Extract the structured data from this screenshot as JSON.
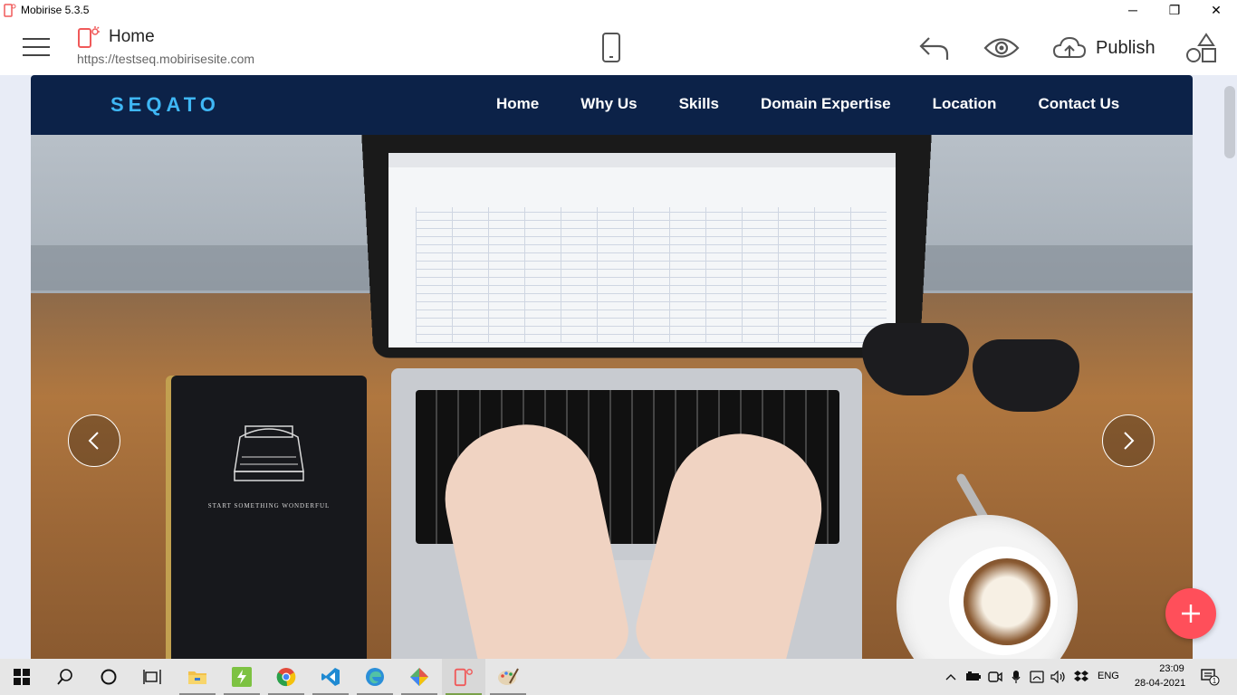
{
  "window": {
    "title": "Mobirise 5.3.5",
    "minimize_glyph": "─",
    "maximize_glyph": "❐",
    "close_glyph": "✕"
  },
  "toolbar": {
    "page_name": "Home",
    "page_url": "https://testseq.mobirisesite.com",
    "publish_label": "Publish",
    "icons": [
      "menu-icon",
      "page-icon",
      "mobile-preview-icon",
      "undo-icon",
      "preview-eye-icon",
      "publish-cloud-icon",
      "blocks-icon"
    ],
    "accent_color": "#ff4f5a"
  },
  "site": {
    "brand": "SEQATO",
    "brand_color": "#3fb7f5",
    "nav_background": "#0c2248",
    "nav_items": [
      {
        "label": "Home"
      },
      {
        "label": "Why Us"
      },
      {
        "label": "Skills"
      },
      {
        "label": "Domain Expertise"
      },
      {
        "label": "Location"
      },
      {
        "label": "Contact Us"
      }
    ],
    "hero": {
      "notebook_text": "START SOMETHING WONDERFUL",
      "image_description_icons": [
        "laptop",
        "hands-typing",
        "notebook",
        "sunglasses",
        "coffee-cup"
      ]
    },
    "carousel": {
      "prev_icon": "chevron-left-icon",
      "next_icon": "chevron-right-icon"
    }
  },
  "fab": {
    "icon": "plus-icon",
    "color": "#ff4f5a"
  },
  "taskbar": {
    "pinned": [
      "windows-start-icon",
      "search-icon",
      "cortana-icon",
      "task-view-icon",
      "file-explorer-icon",
      "app-bolt-icon",
      "chrome-icon",
      "vscode-icon",
      "edge-icon",
      "app-gem-icon",
      "mobirise-icon",
      "paint-icon"
    ],
    "active": "mobirise-icon",
    "tray": {
      "language": "ENG",
      "time": "23:09",
      "date": "28-04-2021",
      "notification_count": "1"
    }
  }
}
